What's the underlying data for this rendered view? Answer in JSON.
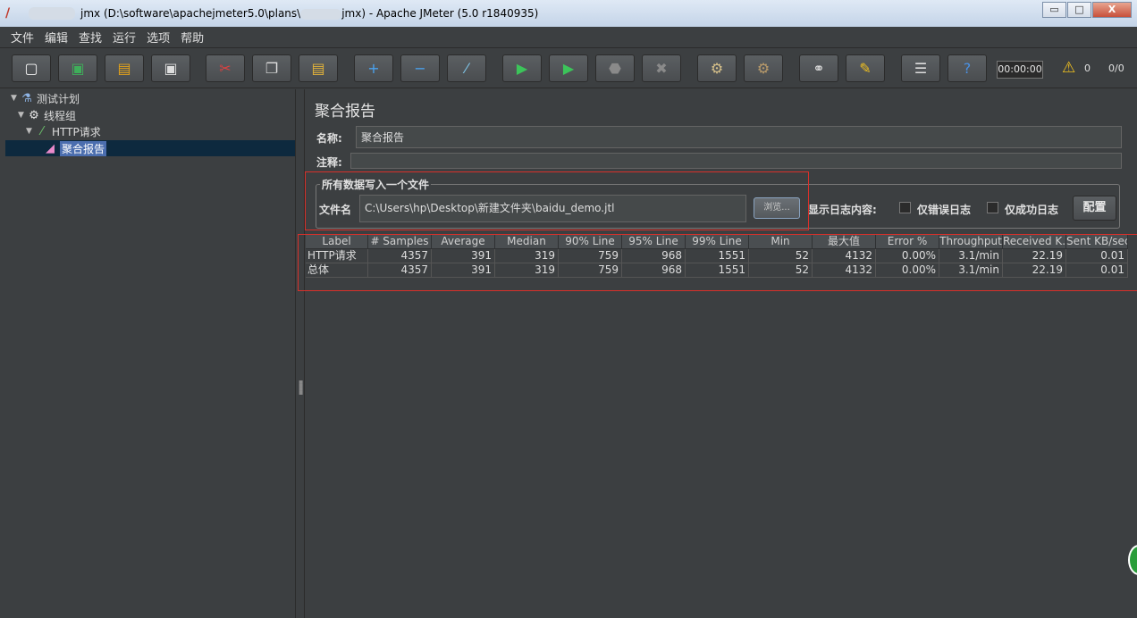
{
  "window": {
    "title_mid": "jmx (D:\\software\\apachejmeter5.0\\plans\\",
    "title_end": "jmx) - Apache JMeter (5.0 r1840935)",
    "minimize": "▭",
    "maximize": "□",
    "close": "X"
  },
  "menu": [
    "文件",
    "编辑",
    "查找",
    "运行",
    "选项",
    "帮助"
  ],
  "toolbar": {
    "buttons": [
      {
        "name": "new-icon",
        "glyph": "▢",
        "color": "#f5f5f5"
      },
      {
        "name": "templates-icon",
        "glyph": "▣",
        "color": "#3fae5a"
      },
      {
        "name": "open-icon",
        "glyph": "▤",
        "color": "#e3a21a"
      },
      {
        "name": "save-icon",
        "glyph": "▣",
        "color": "#dddddd"
      },
      {
        "name": "cut-icon",
        "glyph": "✂",
        "color": "#e04040"
      },
      {
        "name": "copy-icon",
        "glyph": "❐",
        "color": "#dddddd"
      },
      {
        "name": "paste-icon",
        "glyph": "▤",
        "color": "#e3b43a"
      },
      {
        "name": "expand-icon",
        "glyph": "+",
        "color": "#4aa3f0"
      },
      {
        "name": "collapse-icon",
        "glyph": "−",
        "color": "#4aa3f0"
      },
      {
        "name": "toggle-icon",
        "glyph": "⁄",
        "color": "#7ec3e6"
      },
      {
        "name": "start-icon",
        "glyph": "▶",
        "color": "#3cc45a"
      },
      {
        "name": "start-no-pause-icon",
        "glyph": "▶",
        "color": "#3cc45a"
      },
      {
        "name": "stop-icon",
        "glyph": "⬣",
        "color": "#8a8a8a"
      },
      {
        "name": "shutdown-icon",
        "glyph": "✖",
        "color": "#8a8a8a"
      },
      {
        "name": "clear-icon",
        "glyph": "⚙",
        "color": "#d6c08a"
      },
      {
        "name": "clear-all-icon",
        "glyph": "⚙",
        "color": "#b89a6a"
      },
      {
        "name": "search-icon",
        "glyph": "⚭",
        "color": "#dddddd"
      },
      {
        "name": "reset-search-icon",
        "glyph": "✎",
        "color": "#f0c020"
      },
      {
        "name": "function-helper-icon",
        "glyph": "☰",
        "color": "#dddddd"
      },
      {
        "name": "help-icon",
        "glyph": "?",
        "color": "#4a90e2"
      }
    ],
    "timer": "00:00:00",
    "warning_count": "0",
    "thread_count": "0/0"
  },
  "tree": {
    "test_plan": "测试计划",
    "thread_group": "线程组",
    "http_request": "HTTP请求",
    "aggregate_report": "聚合报告"
  },
  "panel": {
    "title": "聚合报告",
    "name_label": "名称:",
    "name_value": "聚合报告",
    "comment_label": "注释:",
    "comment_value": "",
    "fileset_legend": "所有数据写入一个文件",
    "filename_label": "文件名",
    "filename_value": "C:\\Users\\hp\\Desktop\\新建文件夹\\baidu_demo.jtl",
    "browse_label": "浏览...",
    "log_label": "显示日志内容:",
    "errors_only_label": "仅错误日志",
    "success_only_label": "仅成功日志",
    "configure_label": "配置"
  },
  "table": {
    "columns": [
      "Label",
      "# Samples",
      "Average",
      "Median",
      "90% Line",
      "95% Line",
      "99% Line",
      "Min",
      "最大值",
      "Error %",
      "Throughput",
      "Received K...",
      "Sent KB/sec"
    ],
    "rows": [
      [
        "HTTP请求",
        "4357",
        "391",
        "319",
        "759",
        "968",
        "1551",
        "52",
        "4132",
        "0.00%",
        "3.1/min",
        "22.19",
        "0.01"
      ],
      [
        "总体",
        "4357",
        "391",
        "319",
        "759",
        "968",
        "1551",
        "52",
        "4132",
        "0.00%",
        "3.1/min",
        "22.19",
        "0.01"
      ]
    ]
  }
}
